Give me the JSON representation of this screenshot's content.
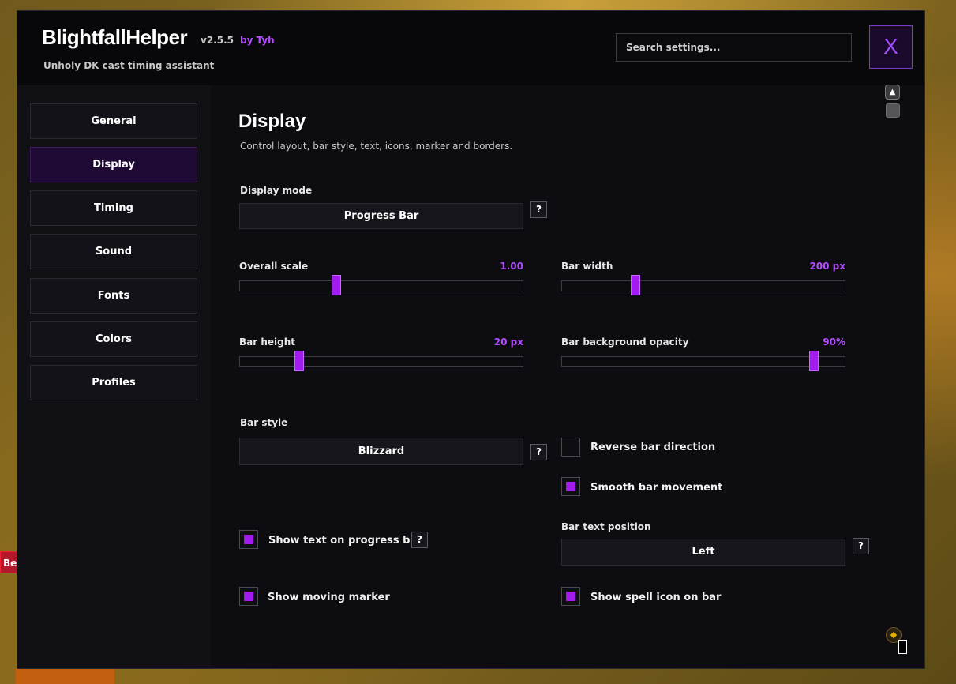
{
  "app": {
    "title": "BlightfallHelper",
    "version": "v2.5.5",
    "author": "by Tyh",
    "subtitle": "Unholy DK cast timing assistant",
    "close_label": "X"
  },
  "search": {
    "placeholder": "Search settings..."
  },
  "sidebar": {
    "items": [
      {
        "label": "General",
        "active": false
      },
      {
        "label": "Display",
        "active": true
      },
      {
        "label": "Timing",
        "active": false
      },
      {
        "label": "Sound",
        "active": false
      },
      {
        "label": "Fonts",
        "active": false
      },
      {
        "label": "Colors",
        "active": false
      },
      {
        "label": "Profiles",
        "active": false
      }
    ]
  },
  "page": {
    "title": "Display",
    "description": "Control layout, bar style, text, icons, marker and borders."
  },
  "settings": {
    "display_mode": {
      "label": "Display mode",
      "value": "Progress Bar",
      "help": "?"
    },
    "overall_scale": {
      "label": "Overall scale",
      "value": "1.00",
      "fraction": 0.34
    },
    "bar_width": {
      "label": "Bar width",
      "value": "200 px",
      "fraction": 0.26
    },
    "bar_height": {
      "label": "Bar height",
      "value": "20 px",
      "fraction": 0.21
    },
    "bar_bg_opacity": {
      "label": "Bar background opacity",
      "value": "90%",
      "fraction": 0.89
    },
    "bar_style": {
      "label": "Bar style",
      "value": "Blizzard",
      "help": "?"
    },
    "reverse_bar": {
      "label": "Reverse bar direction",
      "checked": false
    },
    "smooth_bar": {
      "label": "Smooth bar movement",
      "checked": true
    },
    "show_text": {
      "label": "Show text on progress bar",
      "checked": true,
      "help": "?"
    },
    "bar_text_position": {
      "label": "Bar text position",
      "value": "Left",
      "help": "?"
    },
    "show_marker": {
      "label": "Show moving marker",
      "checked": true
    },
    "show_spell_icon": {
      "label": "Show spell icon on bar",
      "checked": true
    }
  },
  "background": {
    "side_tag": "Be"
  },
  "colors": {
    "accent": "#a21cf0",
    "accent_text": "#b24dff",
    "active_nav": "#1f0a35"
  }
}
